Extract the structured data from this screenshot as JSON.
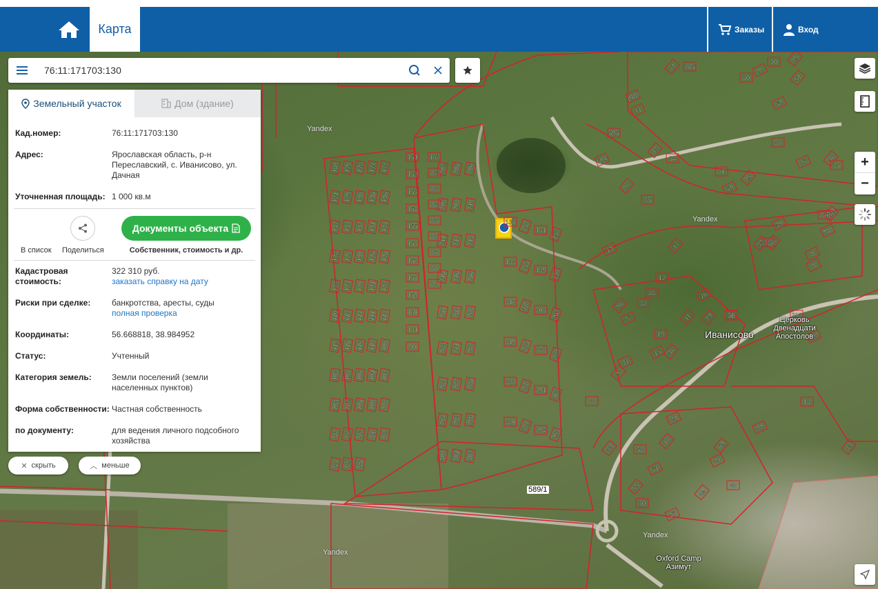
{
  "header": {
    "map_tab": "Карта",
    "orders": "Заказы",
    "login": "Вход"
  },
  "search": {
    "value": "76:11:171703:130"
  },
  "panel": {
    "tab_land": "Земельный участок",
    "tab_house": "Дом (здание)",
    "cad_number_label": "Кад.номер:",
    "cad_number_value": "76:11:171703:130",
    "address_label": "Адрес:",
    "address_value": "Ярославская область, р-н Переславский, с. Иванисово, ул. Дачная",
    "area_label": "Уточненная площадь:",
    "area_value": "1 000 кв.м",
    "to_list": "В список",
    "share": "Поделиться",
    "docs_button": "Документы объекта",
    "docs_sub": "Собственник, стоимость и др.",
    "cost_label": "Кадастровая стоимость:",
    "cost_value": "322 310 руб.",
    "cost_link": "заказать справку на дату",
    "risks_label": "Риски при сделке:",
    "risks_value": "банкротства, аресты, суды",
    "risks_link": "полная проверка",
    "coords_label": "Координаты:",
    "coords_value": "56.668818, 38.984952",
    "status_label": "Статус:",
    "status_value": "Учтенный",
    "category_label": "Категория земель:",
    "category_value": "Земли поселений (земли населенных пунктов)",
    "ownership_label": "Форма собственности:",
    "ownership_value": "Частная собственность",
    "by_doc_label": "по документу:",
    "by_doc_value": "для ведения личного подсобного хозяйства"
  },
  "pills": {
    "hide": "скрыть",
    "less": "меньше"
  },
  "map": {
    "village": "Иванисово",
    "church": "Церковь Двенадцати Апостолов",
    "camp": "Oxford Camp Азимут",
    "yandex": "Yandex",
    "plot_589": "589/1",
    "parcels_left": [
      "151",
      "152",
      "153",
      "154",
      "155",
      "156",
      "157",
      "158",
      "159",
      "160",
      "161",
      "90",
      "162",
      "82",
      "83",
      "84",
      "85",
      "86",
      "87",
      "88",
      "89"
    ],
    "parcels_col2": [
      "204",
      "205",
      "206",
      "209",
      "207",
      "210",
      "211",
      "212",
      "213",
      "215",
      "216",
      "256",
      "257",
      "258",
      "269",
      "268",
      "271",
      "282",
      "283",
      "284",
      "285",
      "297",
      "298",
      "299",
      "300",
      "301",
      "302"
    ],
    "parcels_near": [
      "138",
      "134",
      "131",
      "137",
      "133",
      "135",
      "139",
      "136",
      "317",
      "318",
      "306",
      "264",
      "319",
      "275",
      "276",
      "279",
      "322",
      "288",
      "291",
      "307",
      "320",
      "321",
      "294",
      "293"
    ],
    "parcels_west": [
      "150",
      "149",
      "148",
      "147",
      "142",
      "141",
      "140",
      "139",
      "135",
      "136",
      "134",
      "133",
      "132",
      "131",
      "127",
      "128",
      "129",
      "130",
      "126",
      "125",
      "124",
      "123",
      "120",
      "121",
      "122",
      "119",
      "118",
      "117",
      "111",
      "113",
      "114",
      "115",
      "116",
      "110",
      "109",
      "108",
      "107",
      "106",
      "101",
      "102",
      "103",
      "104",
      "105",
      "100",
      "99",
      "98",
      "97",
      "96",
      "91",
      "92",
      "93",
      "94",
      "95"
    ],
    "parcels_east": [
      "595",
      "594",
      "20",
      "35",
      "13",
      "17",
      "12",
      "16",
      "28",
      "32",
      "27",
      "11",
      "19",
      "15",
      "38",
      "21",
      "31",
      "5",
      "3",
      "24",
      "10",
      "46",
      "34",
      "33",
      "53",
      "51",
      "55",
      "70",
      "37",
      "49",
      "48",
      "8",
      "29",
      "50",
      "8",
      "68",
      "23",
      "39",
      "32",
      "287",
      "288",
      "289",
      "14",
      "22",
      "43",
      "296",
      "292",
      "69",
      "61",
      "59",
      "25",
      "36",
      "27",
      "38",
      "35",
      "41",
      "42",
      "54",
      "52",
      "51",
      "40",
      "9",
      "25",
      "20",
      "1088",
      "71",
      "285"
    ]
  }
}
